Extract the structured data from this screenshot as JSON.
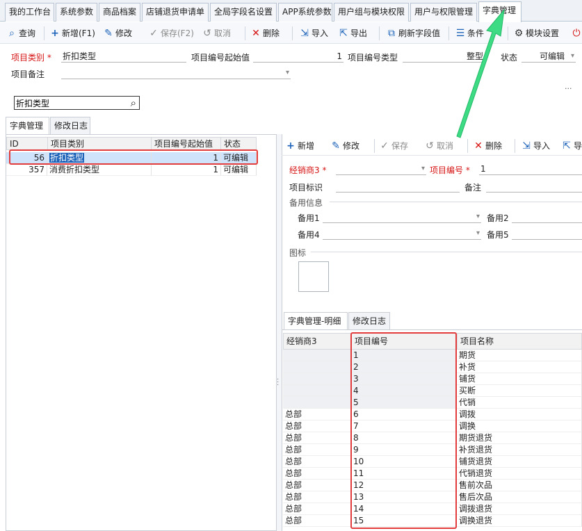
{
  "tabs": [
    {
      "label": "我的工作台"
    },
    {
      "label": "系统参数"
    },
    {
      "label": "商品档案"
    },
    {
      "label": "店铺退货申请单"
    },
    {
      "label": "全局字段名设置"
    },
    {
      "label": "APP系统参数"
    },
    {
      "label": "用户组与模块权限"
    },
    {
      "label": "用户与权限管理"
    },
    {
      "label": "字典管理"
    }
  ],
  "toolbar": {
    "query": "查询",
    "add": "新增(F1)",
    "edit": "修改",
    "save": "保存(F2)",
    "cancel": "取消",
    "delete": "删除",
    "import": "导入",
    "export": "导出",
    "refresh": "刷新字段值",
    "condition": "条件",
    "module_setting": "模块设置"
  },
  "header_form": {
    "category_label": "项目类别",
    "category_value": "折扣类型",
    "start_label": "项目编号起始值",
    "start_value": "1",
    "type_label": "项目编号类型",
    "type_value": "整型",
    "status_label": "状态",
    "status_value": "可编辑",
    "remark_label": "项目备注",
    "more": "···"
  },
  "search": {
    "value": "折扣类型"
  },
  "left_tabs": {
    "dict": "字典管理",
    "log": "修改日志"
  },
  "left_grid": {
    "headers": [
      "ID",
      "项目类别",
      "项目编号起始值",
      "状态"
    ],
    "rows": [
      [
        "56",
        "折扣类型",
        "1",
        "可编辑"
      ],
      [
        "357",
        "消费折扣类型",
        "1",
        "可编辑"
      ]
    ]
  },
  "right_toolbar": {
    "add": "新增",
    "edit": "修改",
    "save": "保存",
    "cancel": "取消",
    "delete": "删除",
    "import": "导入",
    "export": "导"
  },
  "detail_form": {
    "dealer_label": "经销商3",
    "code_label": "项目编号",
    "code_value": "1",
    "ident_label": "项目标识",
    "remark_label": "备注",
    "spare_label": "备用信息",
    "spare1": "备用1",
    "spare2": "备用2",
    "spare4": "备用4",
    "spare5": "备用5",
    "icon_label": "图标"
  },
  "detail_tabs": {
    "detail": "字典管理-明细",
    "log": "修改日志"
  },
  "detail_grid": {
    "headers": [
      "经销商3",
      "项目编号",
      "项目名称"
    ],
    "rows": [
      [
        "",
        "1",
        "期货"
      ],
      [
        "",
        "2",
        "补货"
      ],
      [
        "",
        "3",
        "铺货"
      ],
      [
        "",
        "4",
        "买断"
      ],
      [
        "",
        "5",
        "代销"
      ],
      [
        "总部",
        "6",
        "调拨"
      ],
      [
        "总部",
        "7",
        "调换"
      ],
      [
        "总部",
        "8",
        "期货退货"
      ],
      [
        "总部",
        "9",
        "补货退货"
      ],
      [
        "总部",
        "10",
        "铺货退货"
      ],
      [
        "总部",
        "11",
        "代销退货"
      ],
      [
        "总部",
        "12",
        "售前次品"
      ],
      [
        "总部",
        "13",
        "售后次品"
      ],
      [
        "总部",
        "14",
        "调拨退货"
      ],
      [
        "总部",
        "15",
        "调换退货"
      ]
    ]
  },
  "colors": {
    "accent": "#1c62b9",
    "required": "#d61414",
    "highlight": "#e23b3b",
    "arrow": "#3ddc84"
  }
}
